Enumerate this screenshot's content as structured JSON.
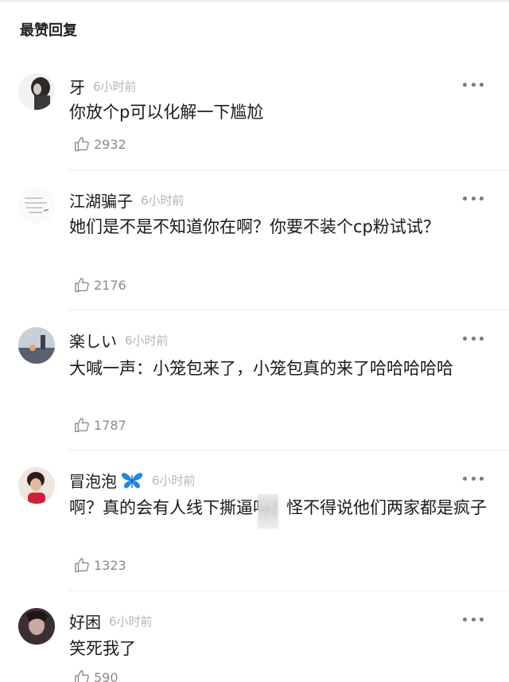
{
  "section": {
    "title": "最赞回复"
  },
  "comments": [
    {
      "name": "牙",
      "time": "6小时前",
      "text": "你放个p可以化解一下尴尬",
      "likes": "2932"
    },
    {
      "name": "江湖骗子",
      "time": "6小时前",
      "text": "她们是不是不知道你在啊？你要不装个cp粉试试？",
      "likes": "2176"
    },
    {
      "name": "楽しい",
      "time": "6小时前",
      "text": "大喊一声：小笼包来了，小笼包真的来了哈哈哈哈哈",
      "likes": "1787"
    },
    {
      "name": "冒泡泡",
      "time": "6小时前",
      "text": "啊？真的会有人线下撕逼吗？怪不得说他们两家都是疯子",
      "likes": "1323",
      "badge_icon": "butterfly-icon"
    },
    {
      "name": "好困",
      "time": "6小时前",
      "text": "笑死我了",
      "likes": "590"
    }
  ],
  "icons": {
    "like": "thumbs-up-outline-icon",
    "more": "more-dots-icon"
  },
  "colors": {
    "text": "#1a1a1a",
    "muted": "#b5b5b5",
    "count": "#8a8a8a",
    "verified": "#1e88e5"
  }
}
